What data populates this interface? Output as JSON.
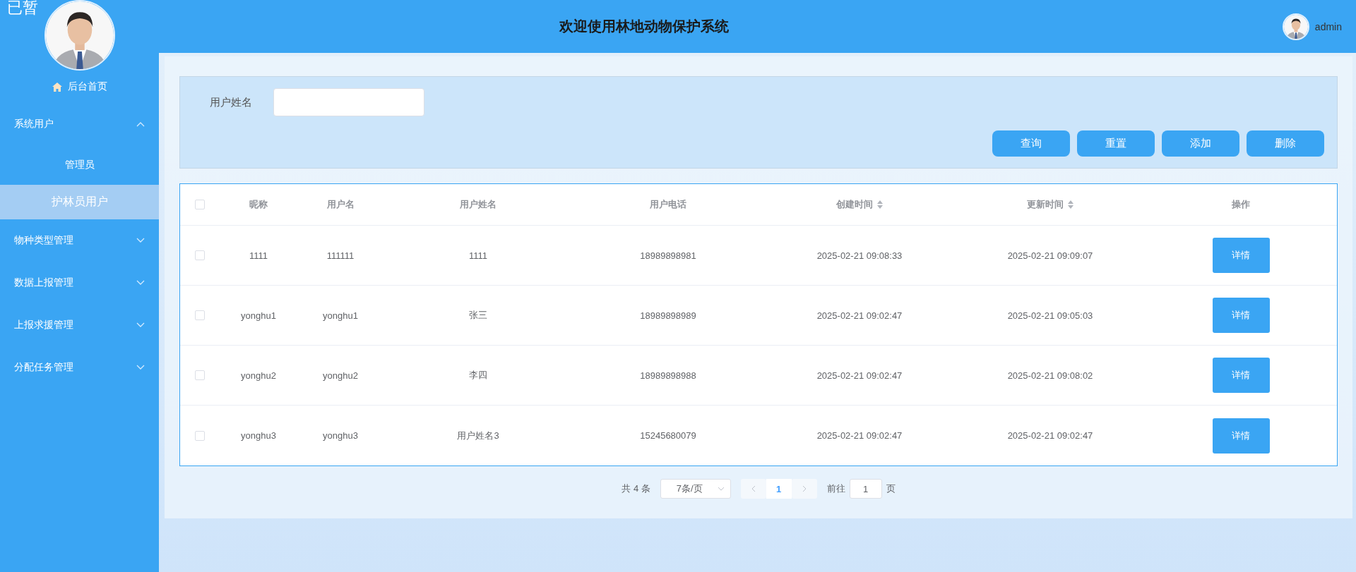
{
  "sidebar": {
    "overlay_text": "已暂",
    "home": {
      "label": "后台首页"
    },
    "menus": [
      {
        "label": "系统用户",
        "expanded": true,
        "children": [
          {
            "label": "管理员",
            "selected": false
          },
          {
            "label": "护林员用户",
            "selected": true
          }
        ]
      },
      {
        "label": "物种类型管理",
        "expanded": false
      },
      {
        "label": "数据上报管理",
        "expanded": false
      },
      {
        "label": "上报求援管理",
        "expanded": false
      },
      {
        "label": "分配任务管理",
        "expanded": false
      }
    ]
  },
  "header": {
    "title": "欢迎使用林地动物保护系统",
    "user": {
      "name": "admin"
    }
  },
  "search": {
    "fields": [
      {
        "label": "用户姓名"
      }
    ],
    "buttons": [
      "查询",
      "重置",
      "添加",
      "删除"
    ]
  },
  "table": {
    "columns": [
      {
        "label": "昵称",
        "sortable": false
      },
      {
        "label": "用户名",
        "sortable": false
      },
      {
        "label": "用户姓名",
        "sortable": false
      },
      {
        "label": "用户电话",
        "sortable": false
      },
      {
        "label": "创建时间",
        "sortable": true
      },
      {
        "label": "更新时间",
        "sortable": true
      },
      {
        "label": "操作",
        "sortable": false
      }
    ],
    "all_checked": false,
    "rows": [
      {
        "checked": false,
        "cells": [
          "1111",
          "111111",
          "1111",
          "18989898981",
          "2025-02-21 09:08:33",
          "2025-02-21 09:09:07"
        ],
        "action": "详情"
      },
      {
        "checked": false,
        "cells": [
          "yonghu1",
          "yonghu1",
          "张三",
          "18989898989",
          "2025-02-21 09:02:47",
          "2025-02-21 09:05:03"
        ],
        "action": "详情"
      },
      {
        "checked": false,
        "cells": [
          "yonghu2",
          "yonghu2",
          "李四",
          "18989898988",
          "2025-02-21 09:02:47",
          "2025-02-21 09:08:02"
        ],
        "action": "详情"
      },
      {
        "checked": false,
        "cells": [
          "yonghu3",
          "yonghu3",
          "用户姓名3",
          "15245680079",
          "2025-02-21 09:02:47",
          "2025-02-21 09:02:47"
        ],
        "action": "详情"
      }
    ]
  },
  "pagination": {
    "total": "共 4 条",
    "page_size": "7条/页",
    "pages": [
      {
        "label": "1",
        "selected": true
      }
    ],
    "goto_label": "前往",
    "goto_value": "1",
    "goto_suffix": "页"
  }
}
